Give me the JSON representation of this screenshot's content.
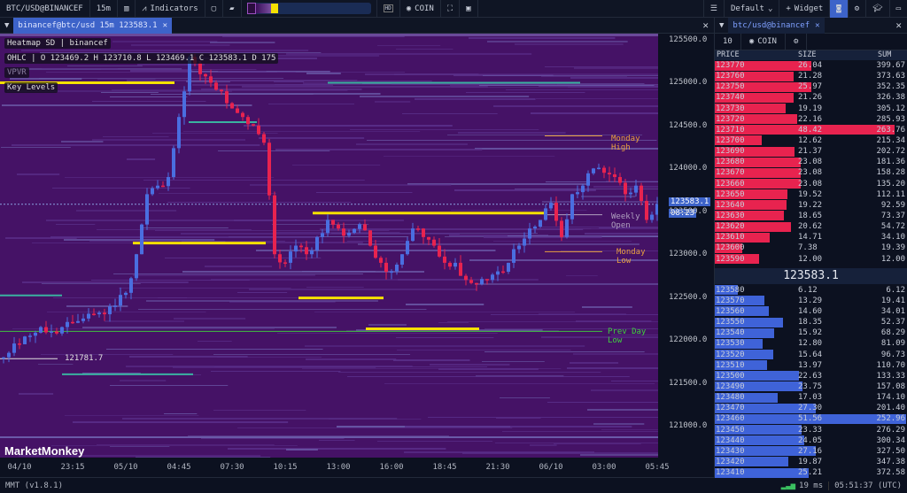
{
  "toolbar": {
    "symbol": "BTC/USD@BINANCEF",
    "interval": "15m",
    "indicators": "Indicators",
    "coin": "COIN",
    "layout": "Default",
    "widget": "Widget"
  },
  "chart_tab": {
    "label": "binancef@btc/usd 15m 123583.1"
  },
  "legend": {
    "heatmap": "Heatmap SD | binancef",
    "ohlc": "OHLC | O 123469.2 H 123710.8 L 123469.1 C 123583.1 D 175",
    "vpvr": "VPVR",
    "key_levels": "Key Levels"
  },
  "price_axis": {
    "ticks": [
      "125500.0",
      "125000.0",
      "124500.0",
      "124000.0",
      "123500.0",
      "123000.0",
      "122500.0",
      "122000.0",
      "121500.0",
      "121000.0"
    ],
    "current_price": "123583.1",
    "countdown": "08:23"
  },
  "time_axis": [
    "04/10",
    "23:15",
    "05/10",
    "04:45",
    "07:30",
    "10:15",
    "13:00",
    "16:00",
    "18:45",
    "21:30",
    "06/10",
    "03:00",
    "05:45"
  ],
  "levels": {
    "monday_high": "Monday High",
    "weekly_open": "Weekly Open",
    "monday_low": "Monday Low",
    "prev_day_low": "Prev Day Low",
    "low_marker": "121781.7"
  },
  "watermark": "MarketMonkey",
  "colors": {
    "up": "#4a6ee0",
    "down": "#e8234f",
    "heatmap_bg": "#451266",
    "key_level": "#f5e000",
    "accent": "#3d63c9"
  },
  "candle_closes": [
    121850,
    121950,
    122050,
    122150,
    122100,
    122150,
    122200,
    122250,
    122300,
    122300,
    122400,
    122550,
    123000,
    123700,
    123800,
    123900,
    124600,
    125300,
    125100,
    125000,
    124900,
    124700,
    124600,
    124500,
    124300,
    123000,
    122900,
    123100,
    123000,
    123200,
    123400,
    123300,
    123250,
    123350,
    123100,
    122900,
    122800,
    123000,
    123300,
    123200,
    123100,
    122900,
    122900,
    122700,
    122650,
    122700,
    122800,
    122900,
    123100,
    123300,
    123400,
    123600,
    123200,
    123700,
    123800,
    124000,
    123950,
    123900,
    123700,
    123800,
    123400,
    123583.1
  ],
  "orderbook": {
    "tab": "btc/usd@binancef",
    "depth": "10",
    "unit": "COIN",
    "headers": {
      "price": "PRICE",
      "size": "SIZE",
      "sum": "SUM"
    },
    "mid_price": "123583.1",
    "asks": [
      [
        "123770",
        "26.04",
        "399.67"
      ],
      [
        "123760",
        "21.28",
        "373.63"
      ],
      [
        "123750",
        "25.97",
        "352.35"
      ],
      [
        "123740",
        "21.26",
        "326.38"
      ],
      [
        "123730",
        "19.19",
        "305.12"
      ],
      [
        "123720",
        "22.16",
        "285.93"
      ],
      [
        "123710",
        "48.42",
        "263.76"
      ],
      [
        "123700",
        "12.62",
        "215.34"
      ],
      [
        "123690",
        "21.37",
        "202.72"
      ],
      [
        "123680",
        "23.08",
        "181.36"
      ],
      [
        "123670",
        "23.08",
        "158.28"
      ],
      [
        "123660",
        "23.08",
        "135.20"
      ],
      [
        "123650",
        "19.52",
        "112.11"
      ],
      [
        "123640",
        "19.22",
        "92.59"
      ],
      [
        "123630",
        "18.65",
        "73.37"
      ],
      [
        "123620",
        "20.62",
        "54.72"
      ],
      [
        "123610",
        "14.71",
        "34.10"
      ],
      [
        "123600",
        "7.38",
        "19.39"
      ],
      [
        "123590",
        "12.00",
        "12.00"
      ]
    ],
    "bids": [
      [
        "123580",
        "6.12",
        "6.12"
      ],
      [
        "123570",
        "13.29",
        "19.41"
      ],
      [
        "123560",
        "14.60",
        "34.01"
      ],
      [
        "123550",
        "18.35",
        "52.37"
      ],
      [
        "123540",
        "15.92",
        "68.29"
      ],
      [
        "123530",
        "12.80",
        "81.09"
      ],
      [
        "123520",
        "15.64",
        "96.73"
      ],
      [
        "123510",
        "13.97",
        "110.70"
      ],
      [
        "123500",
        "22.63",
        "133.33"
      ],
      [
        "123490",
        "23.75",
        "157.08"
      ],
      [
        "123480",
        "17.03",
        "174.10"
      ],
      [
        "123470",
        "27.30",
        "201.40"
      ],
      [
        "123460",
        "51.56",
        "252.96"
      ],
      [
        "123450",
        "23.33",
        "276.29"
      ],
      [
        "123440",
        "24.05",
        "300.34"
      ],
      [
        "123430",
        "27.16",
        "327.50"
      ],
      [
        "123420",
        "19.87",
        "347.38"
      ],
      [
        "123410",
        "25.21",
        "372.58"
      ]
    ]
  },
  "status": {
    "version": "MMT (v1.8.1)",
    "latency": "19 ms",
    "clock": "05:51:37 (UTC)"
  }
}
